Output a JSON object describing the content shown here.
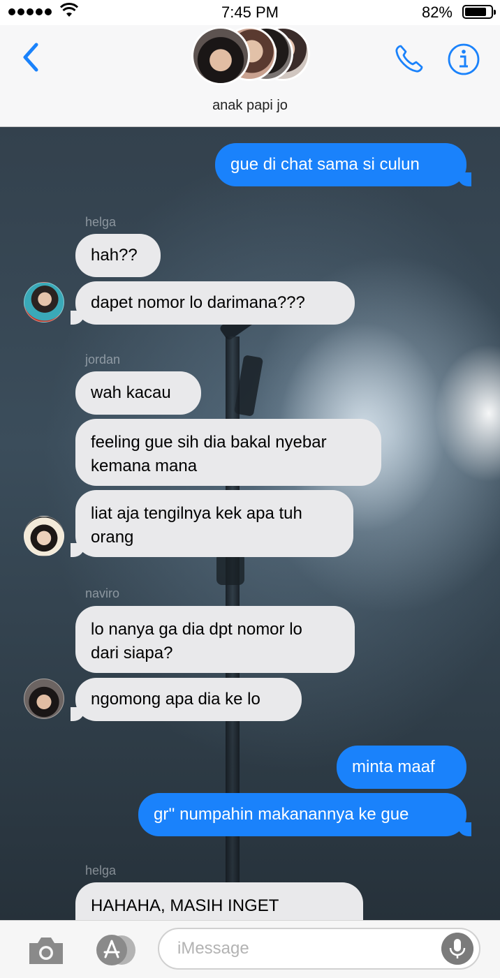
{
  "status_bar": {
    "time": "7:45 PM",
    "battery_percent_text": "82%",
    "battery_level": 0.82,
    "signal_dots": 5
  },
  "header": {
    "group_name": "anak papi jo",
    "back_icon": "chevron-left-icon",
    "call_icon": "phone-icon",
    "info_icon": "info-icon",
    "accent_color": "#1a82fb"
  },
  "messages": [
    {
      "direction": "outgoing",
      "text": "gue di chat sama si culun"
    },
    {
      "sender": "helga"
    },
    {
      "direction": "incoming",
      "text": "hah??"
    },
    {
      "direction": "incoming",
      "text": "dapet nomor lo darimana???"
    },
    {
      "sender": "jordan"
    },
    {
      "direction": "incoming",
      "text": "wah kacau"
    },
    {
      "direction": "incoming",
      "text": "feeling gue sih dia bakal nyebar\nkemana mana"
    },
    {
      "direction": "incoming",
      "text": "liat aja tengilnya kek apa tuh\norang"
    },
    {
      "sender": "naviro"
    },
    {
      "direction": "incoming",
      "text": "lo nanya ga dia dpt nomor lo\ndari siapa?"
    },
    {
      "direction": "incoming",
      "text": "ngomong apa dia ke lo"
    },
    {
      "direction": "outgoing",
      "text": "minta maaf"
    },
    {
      "direction": "outgoing",
      "text": "gr'' numpahin makanannya ke gue"
    },
    {
      "sender": "helga"
    },
    {
      "direction": "incoming",
      "text": "HAHAHA, MASIH INGET"
    }
  ],
  "input_bar": {
    "placeholder": "iMessage",
    "camera_icon": "camera-icon",
    "apps_icon": "app-store-icon",
    "mic_icon": "microphone-icon"
  },
  "colors": {
    "incoming_bubble": "#e9e9eb",
    "outgoing_bubble": "#1a82fb"
  }
}
